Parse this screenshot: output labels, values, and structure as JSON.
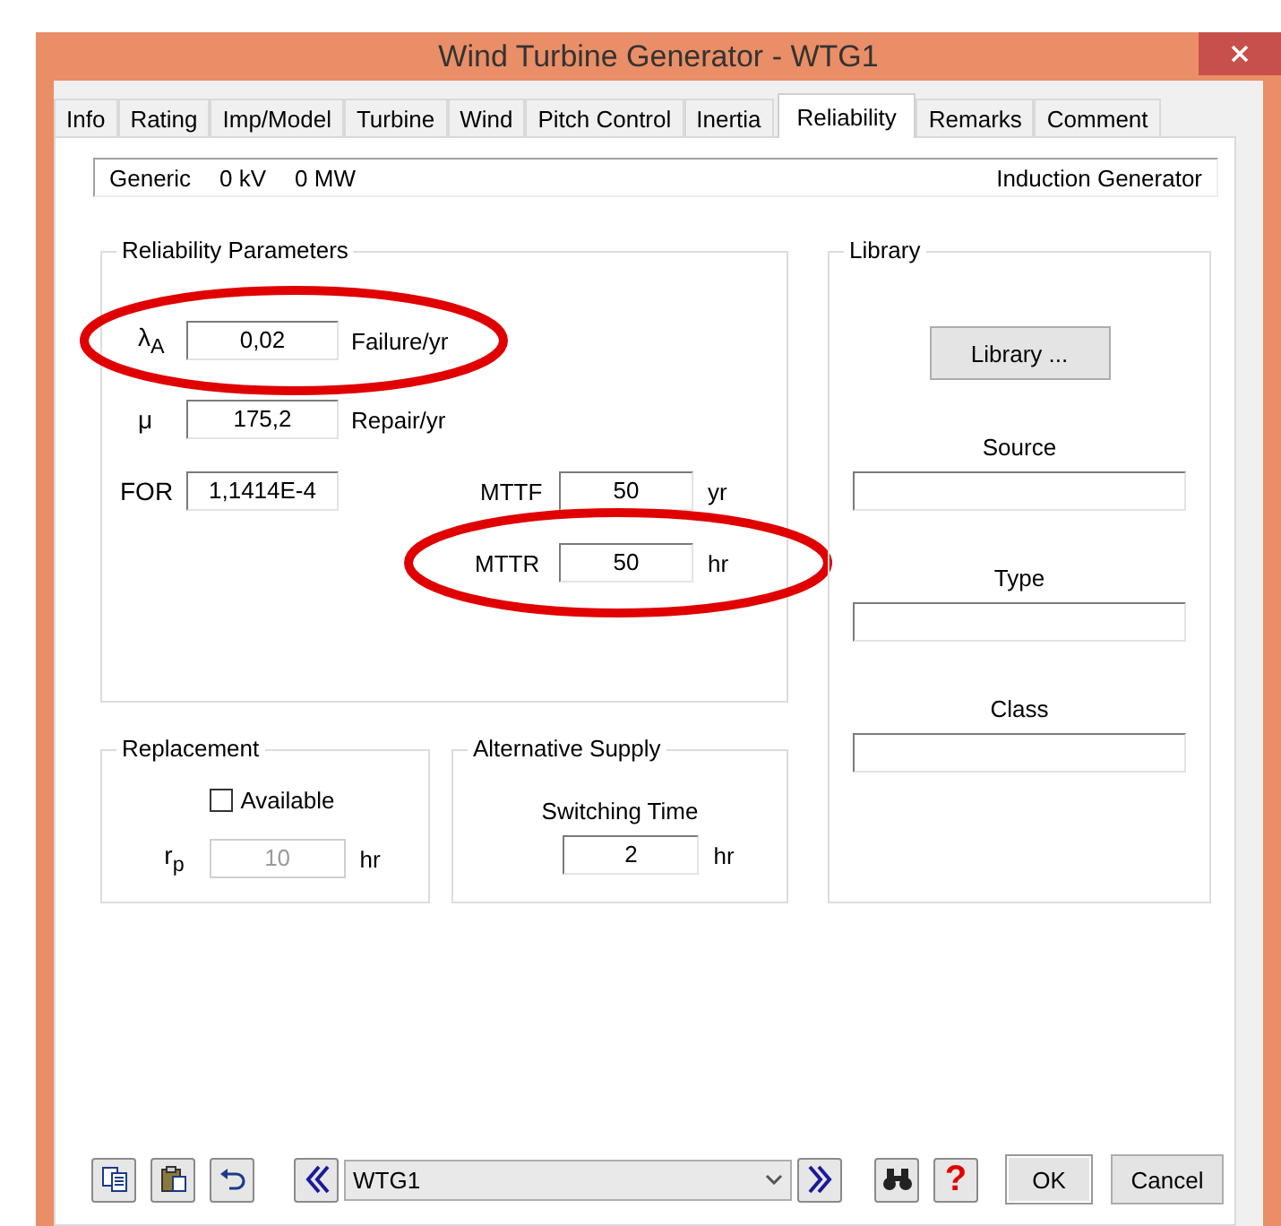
{
  "window": {
    "title": "Wind Turbine Generator - WTG1"
  },
  "tabs": [
    {
      "label": "Info",
      "selected": false
    },
    {
      "label": "Rating",
      "selected": false
    },
    {
      "label": "Imp/Model",
      "selected": false
    },
    {
      "label": "Turbine",
      "selected": false
    },
    {
      "label": "Wind",
      "selected": false
    },
    {
      "label": "Pitch Control",
      "selected": false
    },
    {
      "label": "Inertia",
      "selected": false
    },
    {
      "label": "Reliability",
      "selected": true
    },
    {
      "label": "Remarks",
      "selected": false
    },
    {
      "label": "Comment",
      "selected": false
    }
  ],
  "header": {
    "items": [
      "Generic",
      "0 kV",
      "0 MW"
    ],
    "type": "Induction Generator"
  },
  "reliability_parameters": {
    "title": "Reliability Parameters",
    "rows": [
      {
        "symbol": "λ$_{A}$",
        "value": "0,02",
        "unit": "Failure/yr",
        "highlighted": true
      },
      {
        "symbol": "μ",
        "value": "175,2",
        "unit": "Repair/yr",
        "highlighted": false
      }
    ],
    "for": {
      "label": "FOR",
      "value": "1,1414E-4"
    },
    "mttf": {
      "label": "MTTF",
      "value": "50",
      "unit": "yr",
      "highlighted": false
    },
    "mttr": {
      "label": "MTTR",
      "value": "50",
      "unit": "hr",
      "highlighted": true
    }
  },
  "replacement": {
    "title": "Replacement",
    "available": {
      "label": "Available",
      "checked": false
    },
    "rp": {
      "symbol": "r$_{p}$",
      "value": "10",
      "unit": "hr",
      "disabled": true
    }
  },
  "alternative_supply": {
    "title": "Alternative Supply",
    "label": "Switching Time",
    "value": "2",
    "unit": "hr"
  },
  "library": {
    "title": "Library",
    "button": "Library ...",
    "fields": [
      {
        "label": "Source"
      },
      {
        "label": "Type"
      },
      {
        "label": "Class"
      }
    ]
  },
  "toolbar": {
    "selector": "WTG1",
    "help": "?",
    "buttons": [
      "OK",
      "Cancel"
    ]
  }
}
